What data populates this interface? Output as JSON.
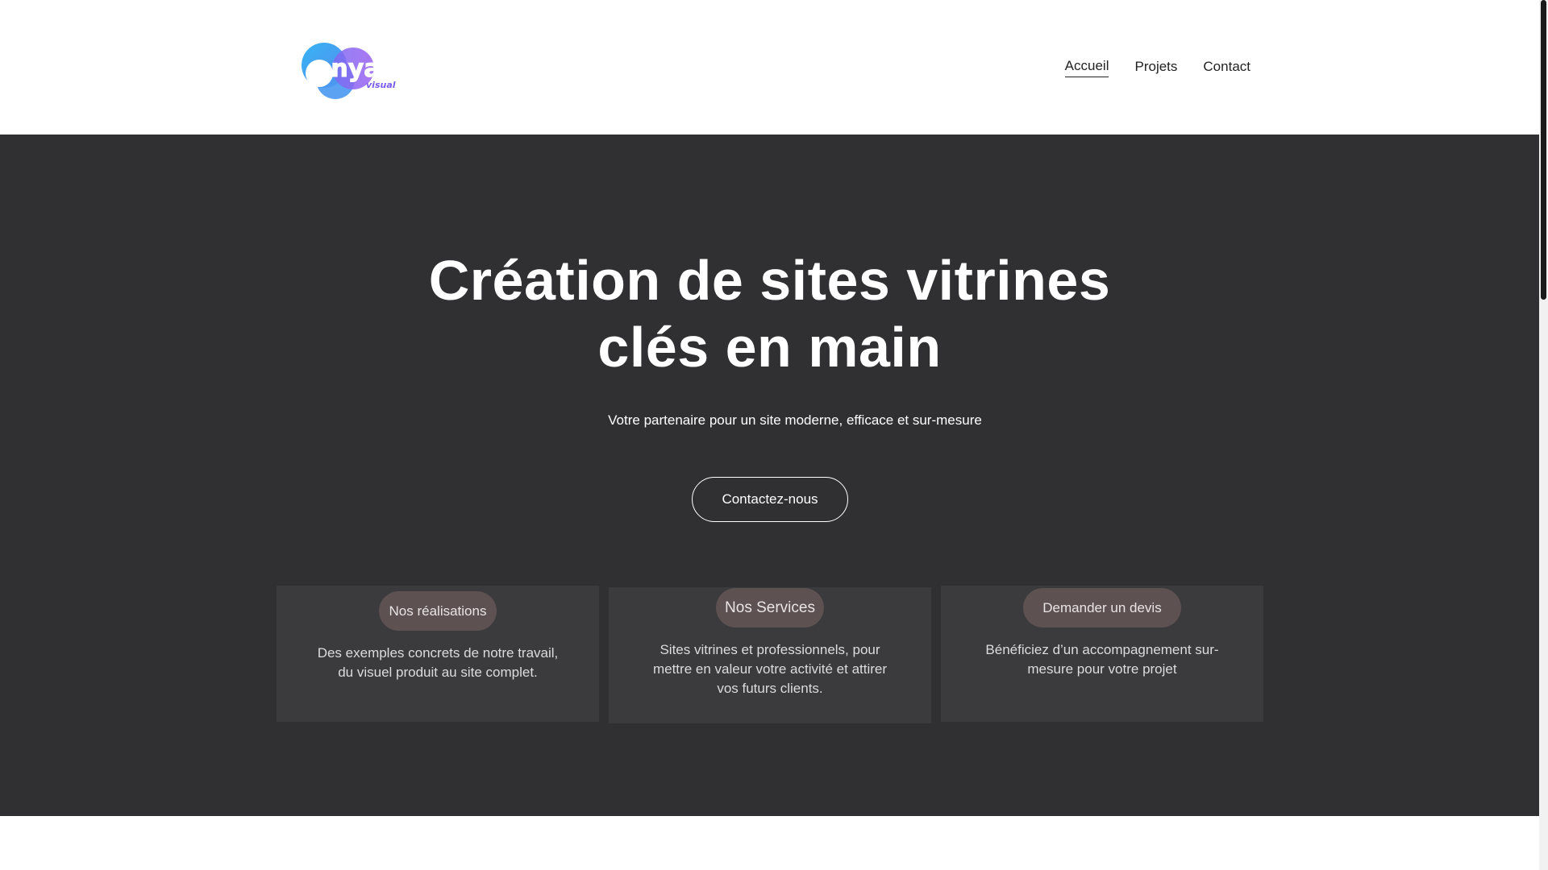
{
  "header": {
    "logo_alt": "enya visual",
    "nav": [
      {
        "label": "Accueil",
        "active": true
      },
      {
        "label": "Projets",
        "active": false
      },
      {
        "label": "Contact",
        "active": false
      }
    ]
  },
  "hero": {
    "title_line1": "Création de sites vitrines",
    "title_line2": "clés en main",
    "subtitle": "Votre partenaire pour un site moderne, efficace et sur-mesure",
    "cta_label": "Contactez-nous"
  },
  "cards": [
    {
      "badge": "Nos réalisations",
      "text": "Des exemples concrets de notre travail, du visuel produit au site complet."
    },
    {
      "badge": "Nos Services",
      "text": "Sites vitrines et professionnels, pour mettre en valeur votre activité et attirer vos futurs clients."
    },
    {
      "badge": "Demander un devis",
      "text": "Bénéficiez d’un accompagnement sur-mesure pour votre projet"
    }
  ],
  "colors": {
    "hero_bg": "#303032",
    "card_bg": "#3b3a3d",
    "badge_bg": "#5d5152",
    "logo_blue": "#3aa8f0",
    "logo_purple": "#7b5cf0"
  }
}
